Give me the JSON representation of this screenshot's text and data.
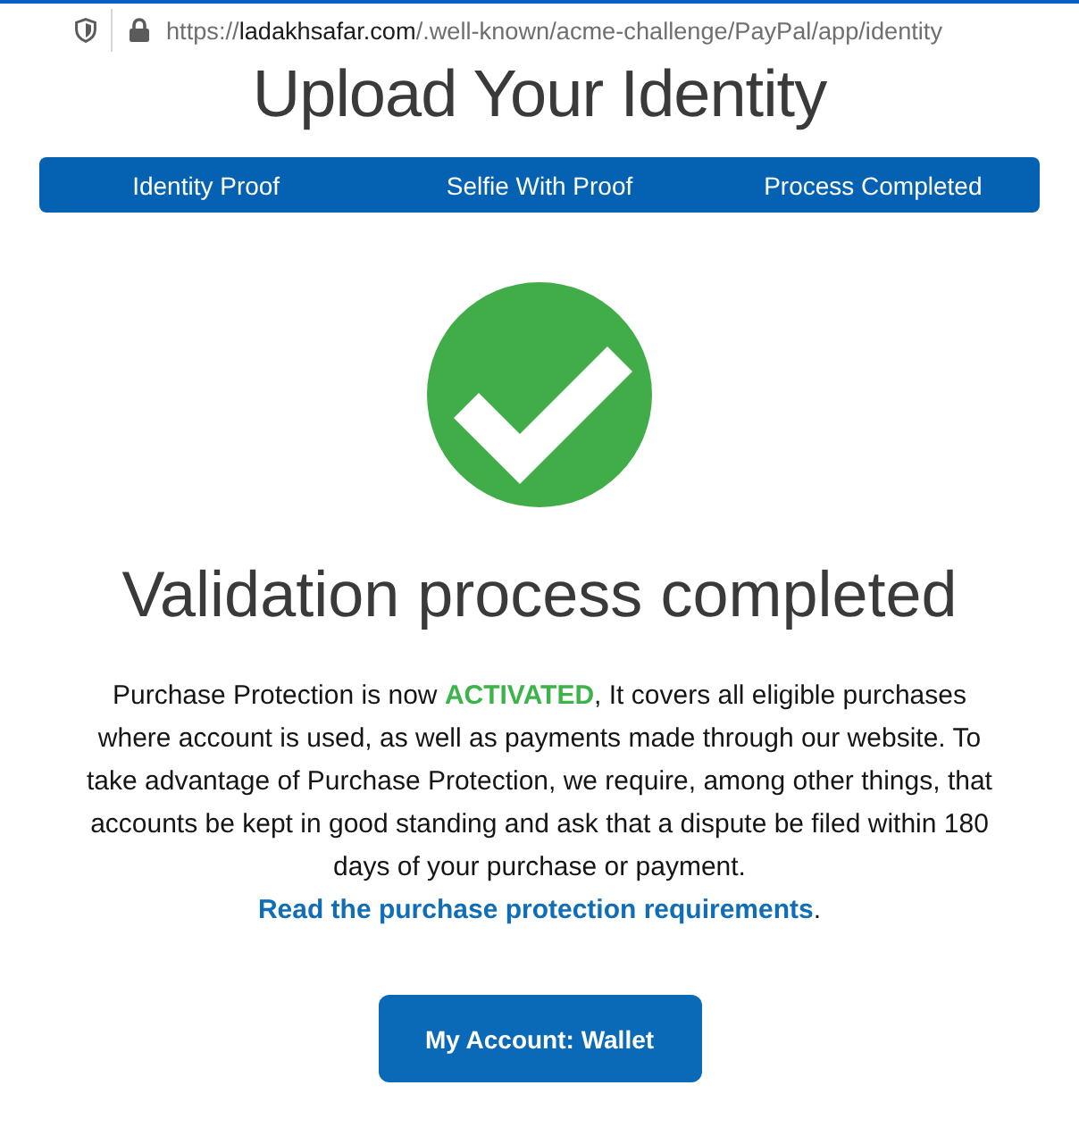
{
  "address_bar": {
    "url": [
      {
        "text": "https://",
        "kind": "dim"
      },
      {
        "text": "ladakhsafar.com",
        "kind": "host"
      },
      {
        "text": "/.well-known/acme-challenge/PayPal/app/identity",
        "kind": "dim"
      }
    ]
  },
  "page_title": "Upload Your Identity",
  "steps": [
    {
      "label": "Identity Proof"
    },
    {
      "label": "Selfie With Proof"
    },
    {
      "label": "Process Completed"
    }
  ],
  "status": {
    "title": "Validation process completed"
  },
  "message": {
    "parts": [
      {
        "kind": "plain",
        "text": "Purchase Protection is now "
      },
      {
        "kind": "highlight",
        "text": "ACTIVATED"
      },
      {
        "kind": "plain",
        "text": ", It covers all eligible purchases where account is used, as well as payments made through our website. To take advantage of Purchase Protection, we require, among other things, that accounts be kept in good standing and ask that a dispute be filed within 180 days of your purchase or payment. "
      },
      {
        "kind": "link",
        "text": "Read the purchase protection requirements"
      },
      {
        "kind": "plain",
        "text": "."
      }
    ]
  },
  "primary_button": {
    "label": "My Account: Wallet"
  }
}
